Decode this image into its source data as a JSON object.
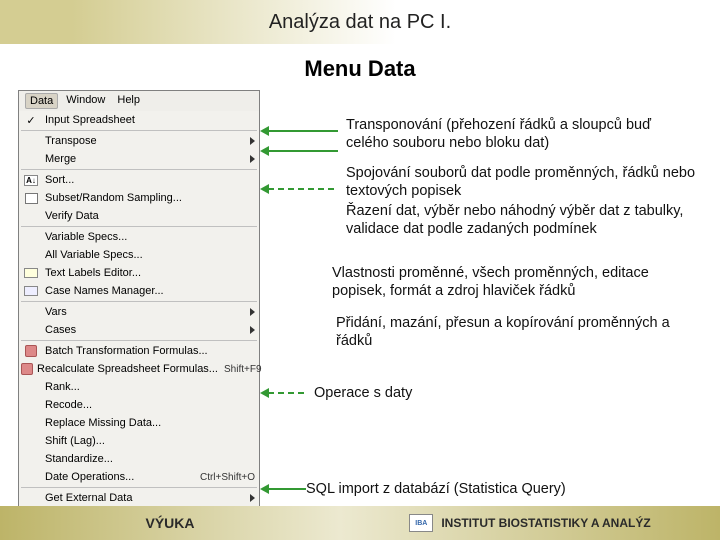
{
  "header": {
    "title": "Analýza dat na PC I.",
    "subtitle": "Menu Data"
  },
  "menubar": [
    "Data",
    "Window",
    "Help"
  ],
  "menu": [
    "Input Spreadsheet",
    "Transpose",
    "Merge",
    "Sort...",
    "Subset/Random Sampling...",
    "Verify Data",
    "Variable Specs...",
    "All Variable Specs...",
    "Text Labels Editor...",
    "Case Names Manager...",
    "Vars",
    "Cases",
    "Batch Transformation Formulas...",
    "Recalculate Spreadsheet Formulas...",
    "Rank...",
    "Recode...",
    "Replace Missing Data...",
    "Shift (Lag)...",
    "Standardize...",
    "Date Operations...",
    "Get External Data"
  ],
  "shortcuts": {
    "recalc": "Shift+F9",
    "dateops": "Ctrl+Shift+O"
  },
  "explain": [
    "Transponování (přehození řádků a sloupců buď celého souboru nebo bloku dat)",
    "Spojování souborů dat podle proměnných, řádků nebo textových popisek",
    "Řazení dat, výběr nebo náhodný výběr dat z tabulky, validace dat podle zadaných podmínek",
    "Vlastnosti proměnné, všech proměnných, editace popisek, formát a zdroj hlaviček řádků",
    "Přidání, mazání, přesun a kopírování proměnných a řádků",
    "Operace s daty",
    "SQL import z databází (Statistica Query)"
  ],
  "footer": {
    "left": "VÝUKA",
    "right": "INSTITUT BIOSTATISTIKY A ANALÝZ"
  }
}
